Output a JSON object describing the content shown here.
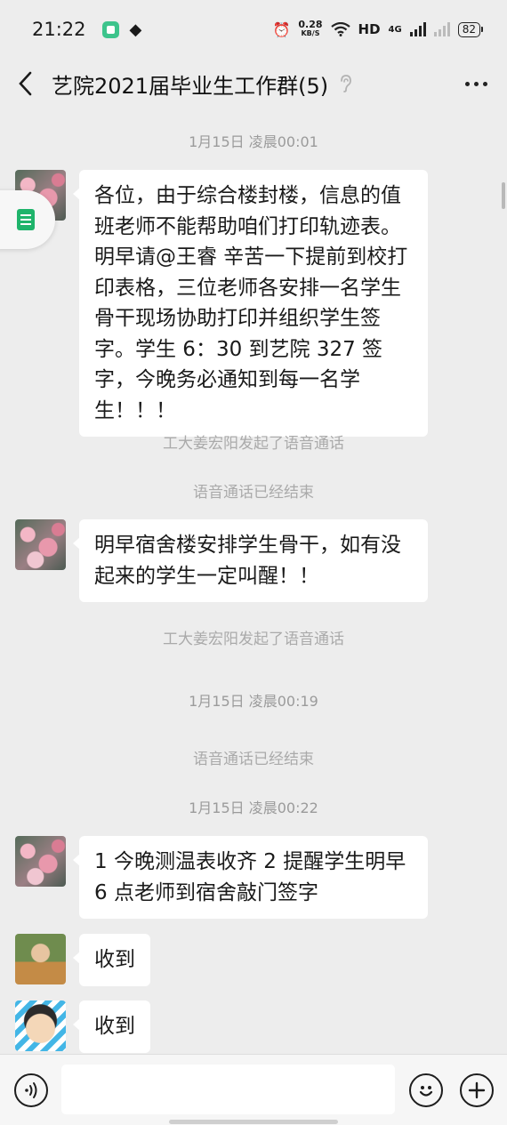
{
  "status_bar": {
    "time": "21:22",
    "layers_icon": "◆",
    "alarm_icon": "⏰",
    "net_speed_value": "0.28",
    "net_speed_unit": "KB/S",
    "wifi_icon": "wifi-icon",
    "hd_label": "HD",
    "network_label": "4G",
    "battery": "82"
  },
  "header": {
    "title": "艺院2021届毕业生工作群(5)",
    "ear_icon": "ear-icon"
  },
  "messages": [
    {
      "kind": "time",
      "text": "1月15日 凌晨00:01"
    },
    {
      "kind": "msg",
      "avatar": "blossom",
      "text": "各位，由于综合楼封楼，信息的值班老师不能帮助咱们打印轨迹表。明早请@王睿 辛苦一下提前到校打印表格，三位老师各安排一名学生骨干现场协助打印并组织学生签字。学生 6：30 到艺院 327 签字，今晚务必通知到每一名学生！！！"
    },
    {
      "kind": "system",
      "text": "工大姜宏阳发起了语音通话"
    },
    {
      "kind": "system",
      "text": "语音通话已经结束"
    },
    {
      "kind": "msg",
      "avatar": "blossom",
      "text": "明早宿舍楼安排学生骨干，如有没起来的学生一定叫醒！！"
    },
    {
      "kind": "system",
      "text": "工大姜宏阳发起了语音通话"
    },
    {
      "kind": "time",
      "text": "1月15日 凌晨00:19"
    },
    {
      "kind": "system",
      "text": "语音通话已经结束"
    },
    {
      "kind": "time",
      "text": "1月15日 凌晨00:22"
    },
    {
      "kind": "msg",
      "avatar": "blossom",
      "text": "1 今晚测温表收齐 2 提醒学生明早 6 点老师到宿舍敲门签字"
    },
    {
      "kind": "msg",
      "avatar": "boy",
      "text": "收到"
    },
    {
      "kind": "msg",
      "avatar": "cartoon",
      "text": "收到"
    }
  ],
  "input_bar": {
    "placeholder": "",
    "voice_icon": "voice-icon",
    "emoji_icon": "emoji-icon",
    "plus_icon": "plus-icon"
  },
  "float_widget": {
    "icon": "doc-icon"
  }
}
